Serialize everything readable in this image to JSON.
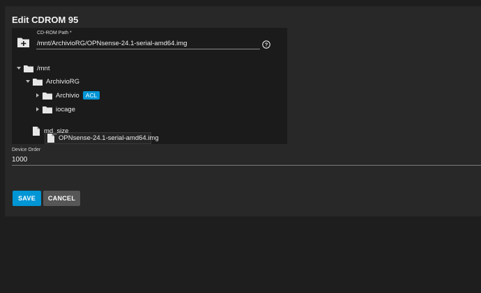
{
  "dialog": {
    "title": "Edit CDROM 95"
  },
  "explorer": {
    "path_label": "CD-ROM Path *",
    "path_value": "/mnt/ArchivioRG/OPNsense-24.1-serial-amd64.img",
    "tree": {
      "root": "/mnt",
      "archiviorg": "ArchivioRG",
      "archivio": "Archivio",
      "acl_badge": "ACL",
      "iocage": "iocage",
      "selected_file": "OPNsense-24.1-serial-amd64.img",
      "md_size": "md_size"
    }
  },
  "device_order": {
    "label": "Device Order",
    "value": "1000"
  },
  "buttons": {
    "save": "SAVE",
    "cancel": "CANCEL"
  },
  "colors": {
    "accent": "#0095d5",
    "cancel": "#565656",
    "card": "#282828",
    "explorer": "#1b1b1b",
    "background": "#1e1e1e"
  }
}
